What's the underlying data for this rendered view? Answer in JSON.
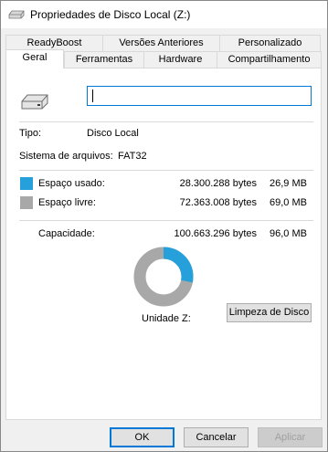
{
  "window": {
    "title": "Propriedades de Disco Local (Z:)"
  },
  "tabs": {
    "row1": [
      {
        "label": "ReadyBoost"
      },
      {
        "label": "Versões Anteriores"
      },
      {
        "label": "Personalizado"
      }
    ],
    "row2": [
      {
        "label": "Geral",
        "active": true
      },
      {
        "label": "Ferramentas"
      },
      {
        "label": "Hardware"
      },
      {
        "label": "Compartilhamento"
      }
    ]
  },
  "general": {
    "drive_name_value": "",
    "type_label": "Tipo:",
    "type_value": "Disco Local",
    "fs_label": "Sistema de arquivos:",
    "fs_value": "FAT32",
    "used": {
      "label": "Espaço usado:",
      "bytes": "28.300.288 bytes",
      "size": "26,9 MB",
      "color": "#26a0da"
    },
    "free": {
      "label": "Espaço livre:",
      "bytes": "72.363.008 bytes",
      "size": "69,0 MB",
      "color": "#a8a8a8"
    },
    "capacity": {
      "label": "Capacidade:",
      "bytes": "100.663.296 bytes",
      "size": "96,0 MB"
    },
    "used_fraction": 0.281,
    "drive_label": "Unidade Z:",
    "cleanup_label": "Limpeza de Disco"
  },
  "footer": {
    "ok_label": "OK",
    "cancel_label": "Cancelar",
    "apply_label": "Aplicar"
  },
  "icons": {
    "title": "drive-icon",
    "large": "drive-icon"
  }
}
